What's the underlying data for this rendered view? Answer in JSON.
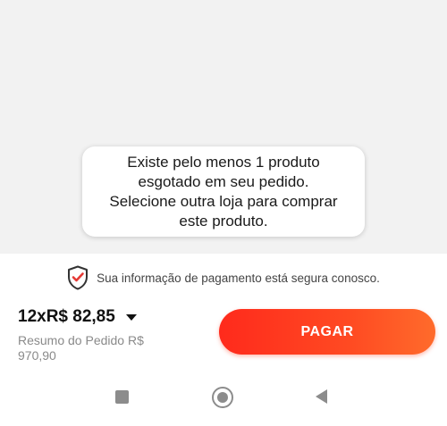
{
  "toast": {
    "message_line1": "Existe pelo menos 1 produto",
    "message_line2": "esgotado em seu pedido.",
    "message_line3": "Selecione outra loja para comprar",
    "message_line4": "este produto."
  },
  "security": {
    "icon": "shield-check-icon",
    "text": "Sua informação de pagamento está segura conosco."
  },
  "order": {
    "total_label": "12xR$ 82,85",
    "summary_label": "Resumo do Pedido R$ 970,90"
  },
  "pay_button": {
    "label": "PAGAR"
  },
  "colors": {
    "accent": "#ff3b1f",
    "shield_red": "#e53935",
    "shield_dark": "#333333"
  },
  "navbar": {
    "recent_icon": "square-recent-icon",
    "home_icon": "circle-home-icon",
    "back_icon": "triangle-back-icon"
  }
}
